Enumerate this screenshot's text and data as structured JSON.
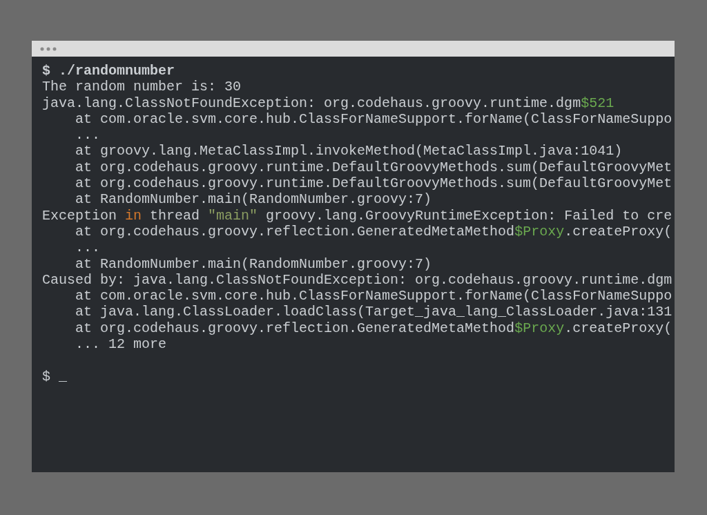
{
  "terminal": {
    "lines": [
      {
        "kind": "command",
        "segments": [
          {
            "kind": "text",
            "text": "$ ./randomnumber"
          }
        ]
      },
      {
        "kind": "output",
        "segments": [
          {
            "kind": "text",
            "text": "The random number is: 30"
          }
        ]
      },
      {
        "kind": "output",
        "segments": [
          {
            "kind": "text",
            "text": "java.lang.ClassNotFoundException: org.codehaus.groovy.runtime.dgm"
          },
          {
            "kind": "variable",
            "text": "$521"
          }
        ]
      },
      {
        "kind": "output",
        "segments": [
          {
            "kind": "text",
            "text": "    at com.oracle.svm.core.hub.ClassForNameSupport.forName(ClassForNameSuppo"
          }
        ]
      },
      {
        "kind": "output",
        "segments": [
          {
            "kind": "text",
            "text": "    ..."
          }
        ]
      },
      {
        "kind": "output",
        "segments": [
          {
            "kind": "text",
            "text": "    at groovy.lang.MetaClassImpl.invokeMethod(MetaClassImpl.java:1041)"
          }
        ]
      },
      {
        "kind": "output",
        "segments": [
          {
            "kind": "text",
            "text": "    at org.codehaus.groovy.runtime.DefaultGroovyMethods.sum(DefaultGroovyMet"
          }
        ]
      },
      {
        "kind": "output",
        "segments": [
          {
            "kind": "text",
            "text": "    at org.codehaus.groovy.runtime.DefaultGroovyMethods.sum(DefaultGroovyMet"
          }
        ]
      },
      {
        "kind": "output",
        "segments": [
          {
            "kind": "text",
            "text": "    at RandomNumber.main(RandomNumber.groovy:7)"
          }
        ]
      },
      {
        "kind": "output",
        "segments": [
          {
            "kind": "text",
            "text": "Exception "
          },
          {
            "kind": "keyword",
            "text": "in"
          },
          {
            "kind": "text",
            "text": " thread "
          },
          {
            "kind": "string",
            "text": "\"main\""
          },
          {
            "kind": "text",
            "text": " groovy.lang.GroovyRuntimeException: Failed to cre"
          }
        ]
      },
      {
        "kind": "output",
        "segments": [
          {
            "kind": "text",
            "text": "    at org.codehaus.groovy.reflection.GeneratedMetaMethod"
          },
          {
            "kind": "variable",
            "text": "$Proxy"
          },
          {
            "kind": "text",
            "text": ".createProxy("
          }
        ]
      },
      {
        "kind": "output",
        "segments": [
          {
            "kind": "text",
            "text": "    ..."
          }
        ]
      },
      {
        "kind": "output",
        "segments": [
          {
            "kind": "text",
            "text": "    at RandomNumber.main(RandomNumber.groovy:7)"
          }
        ]
      },
      {
        "kind": "output",
        "segments": [
          {
            "kind": "text",
            "text": "Caused by: java.lang.ClassNotFoundException: org.codehaus.groovy.runtime.dgm"
          }
        ]
      },
      {
        "kind": "output",
        "segments": [
          {
            "kind": "text",
            "text": "    at com.oracle.svm.core.hub.ClassForNameSupport.forName(ClassForNameSuppo"
          }
        ]
      },
      {
        "kind": "output",
        "segments": [
          {
            "kind": "text",
            "text": "    at java.lang.ClassLoader.loadClass(Target_java_lang_ClassLoader.java:131"
          }
        ]
      },
      {
        "kind": "output",
        "segments": [
          {
            "kind": "text",
            "text": "    at org.codehaus.groovy.reflection.GeneratedMetaMethod"
          },
          {
            "kind": "variable",
            "text": "$Proxy"
          },
          {
            "kind": "text",
            "text": ".createProxy("
          }
        ]
      },
      {
        "kind": "output",
        "segments": [
          {
            "kind": "text",
            "text": "    ... 12 more"
          }
        ]
      },
      {
        "kind": "blank"
      },
      {
        "kind": "output",
        "segments": [
          {
            "kind": "text",
            "text": "$ _"
          }
        ]
      }
    ]
  }
}
